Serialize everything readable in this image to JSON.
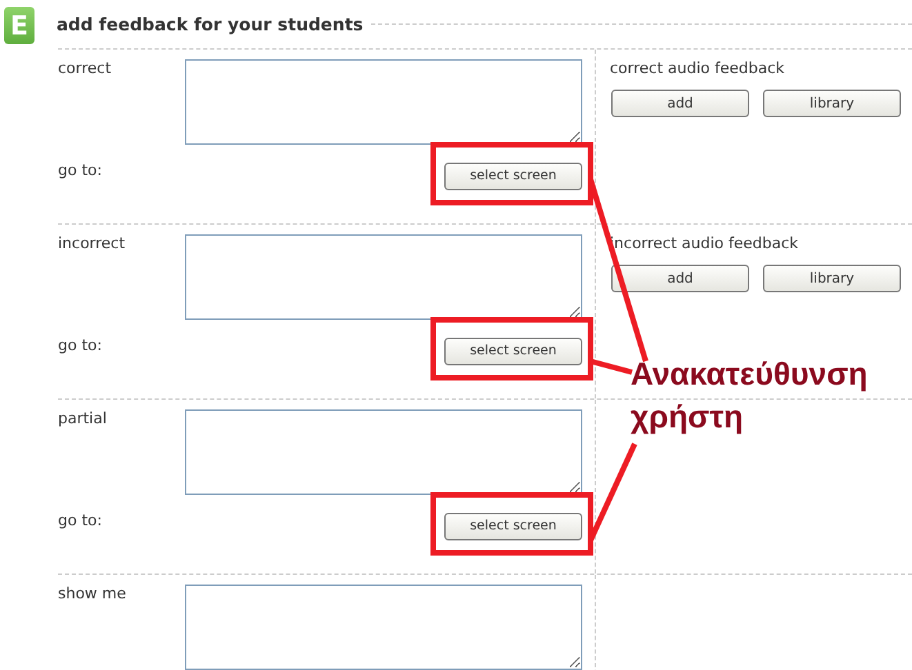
{
  "header": {
    "badge": "E",
    "title": "add feedback for your students"
  },
  "sections": [
    {
      "label": "correct",
      "goto": {
        "label": "go to:",
        "button": "select screen",
        "highlighted": true
      },
      "audio": {
        "label": "correct audio feedback",
        "buttons": [
          "add",
          "library"
        ]
      }
    },
    {
      "label": "incorrect",
      "goto": {
        "label": "go to:",
        "button": "select screen",
        "highlighted": true
      },
      "audio": {
        "label": "incorrect audio feedback",
        "buttons": [
          "add",
          "library"
        ]
      }
    },
    {
      "label": "partial",
      "goto": {
        "label": "go to:",
        "button": "select screen",
        "highlighted": true
      }
    },
    {
      "label": "show me"
    }
  ],
  "annotation": {
    "text": "Ανακατεύθυνση χρήστη"
  }
}
